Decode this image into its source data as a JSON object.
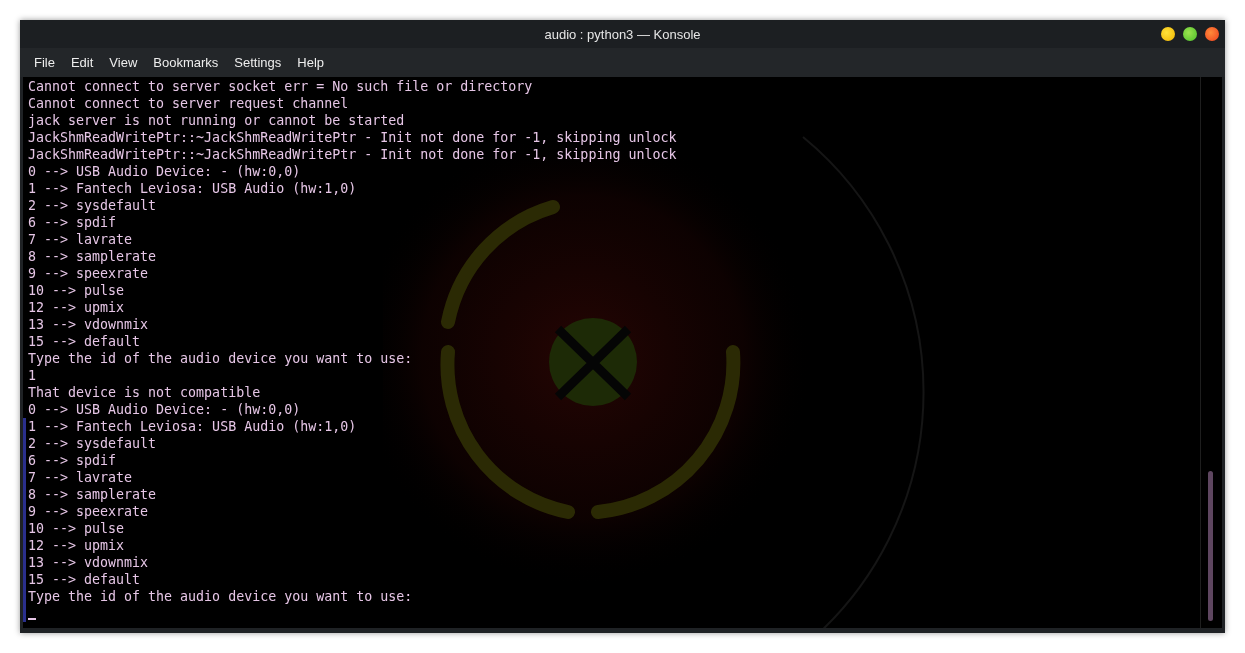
{
  "window": {
    "title": "audio : python3 — Konsole"
  },
  "menu": [
    "File",
    "Edit",
    "View",
    "Bookmarks",
    "Settings",
    "Help"
  ],
  "terminal": {
    "lines": [
      "Cannot connect to server socket err = No such file or directory",
      "Cannot connect to server request channel",
      "jack server is not running or cannot be started",
      "JackShmReadWritePtr::~JackShmReadWritePtr - Init not done for -1, skipping unlock",
      "JackShmReadWritePtr::~JackShmReadWritePtr - Init not done for -1, skipping unlock",
      "0 --> USB Audio Device: - (hw:0,0)",
      "1 --> Fantech Leviosa: USB Audio (hw:1,0)",
      "2 --> sysdefault",
      "6 --> spdif",
      "7 --> lavrate",
      "8 --> samplerate",
      "9 --> speexrate",
      "10 --> pulse",
      "12 --> upmix",
      "13 --> vdownmix",
      "15 --> default",
      "Type the id of the audio device you want to use:",
      "1",
      "That device is not compatible",
      "0 --> USB Audio Device: - (hw:0,0)",
      "1 --> Fantech Leviosa: USB Audio (hw:1,0)",
      "2 --> sysdefault",
      "6 --> spdif",
      "7 --> lavrate",
      "8 --> samplerate",
      "9 --> speexrate",
      "10 --> pulse",
      "12 --> upmix",
      "13 --> vdownmix",
      "15 --> default",
      "Type the id of the audio device you want to use:"
    ]
  }
}
